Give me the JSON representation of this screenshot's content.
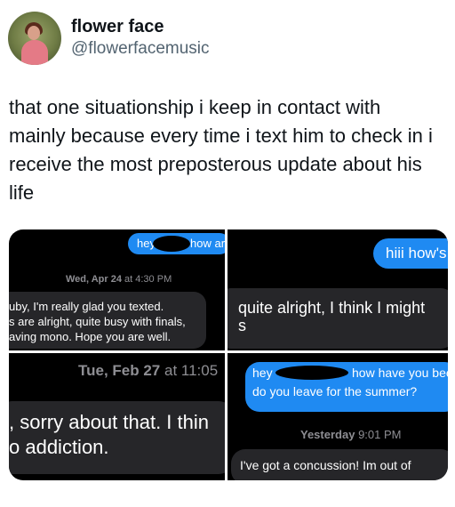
{
  "profile": {
    "display_name": "flower face",
    "handle": "@flowerfacemusic"
  },
  "tweet": {
    "lines": [
      "that one situationship i keep in contact with",
      "mainly because every time i text him to check in i",
      "receive the most preposterous update about his",
      "life"
    ]
  },
  "screenshots": {
    "panel1": {
      "sent_hey": "hey",
      "sent_rest": "how are",
      "timestamp_day": "Wed, Apr 24",
      "timestamp_time": "at 4:30 PM",
      "reply_lines": [
        "uby, I'm really glad you texted.",
        "s are alright, quite busy with finals,",
        "aving mono. Hope you are well."
      ]
    },
    "panel2": {
      "sent": "hiii how's",
      "reply_lines": [
        "quite alright, I think I might",
        "s"
      ]
    },
    "panel3": {
      "timestamp_day": "Tue, Feb 27",
      "timestamp_time": "at 11:05",
      "reply_lines": [
        ", sorry about that. I thin",
        "o addiction."
      ]
    },
    "panel4": {
      "sent_hey": "hey",
      "sent_line1_rest": "how have you been",
      "sent_line2": "do you leave for the summer?",
      "timestamp_day": "Yesterday",
      "timestamp_time": "9:01 PM",
      "reply": "I've got a concussion! Im out of"
    }
  },
  "colors": {
    "imessage_blue": "#1f8af2",
    "bubble_gray": "#262629",
    "timestamp_gray": "#8e8e93",
    "handle_gray": "#536471"
  }
}
